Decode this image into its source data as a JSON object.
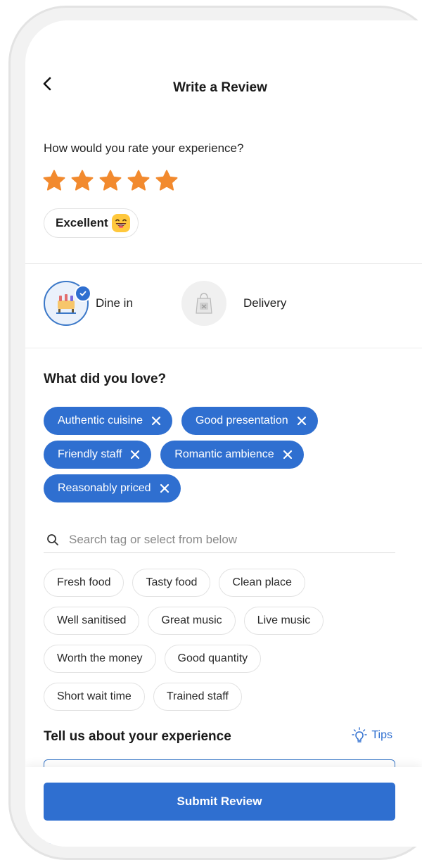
{
  "header": {
    "title": "Write a Review"
  },
  "rating": {
    "question": "How would you rate your experience?",
    "value": 5,
    "max": 5,
    "label": "Excellent",
    "star_color": "#f28a2e"
  },
  "order_modes": [
    {
      "label": "Dine in",
      "selected": true
    },
    {
      "label": "Delivery",
      "selected": false
    }
  ],
  "loved": {
    "title": "What did you love?",
    "selected_tags": [
      "Authentic cuisine",
      "Good presentation",
      "Friendly staff",
      "Romantic ambience",
      "Reasonably priced"
    ],
    "search_placeholder": "Search tag or select from below",
    "suggested_tags": [
      "Fresh food",
      "Tasty food",
      "Clean place",
      "Well sanitised",
      "Great music",
      "Live music",
      "Worth the money",
      "Good quantity",
      "Short wait time",
      "Trained staff"
    ]
  },
  "experience": {
    "title": "Tell us about your experience",
    "tips_label": "Tips"
  },
  "submit_label": "Submit Review",
  "colors": {
    "accent": "#2f6fd0",
    "star": "#f28a2e"
  }
}
